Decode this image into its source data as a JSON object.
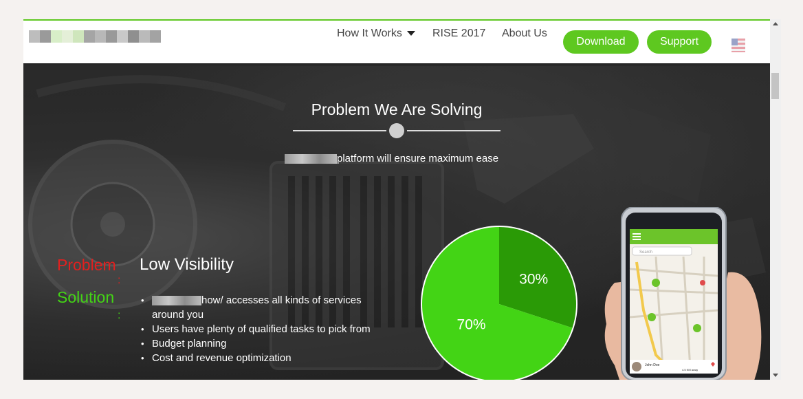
{
  "nav": {
    "how_it_works": "How It Works",
    "rise": "RISE 2017",
    "about": "About Us",
    "download": "Download",
    "support": "Support"
  },
  "colors": {
    "accent": "#5ec820",
    "problem": "#e2201f",
    "solution": "#43d415",
    "pie_light": "#43d415",
    "pie_dark": "#2a9a06"
  },
  "section": {
    "title": "Problem We Are Solving",
    "subtitle": "platform will ensure maximum ease"
  },
  "problem": {
    "problem_label": "Problem",
    "solution_label": "Solution",
    "colon": ":",
    "heading": "Low Visibility",
    "bullets": [
      "how/ accesses all kinds of services around you",
      "Users have plenty of qualified tasks to pick from",
      "Budget planning",
      "Cost and revenue optimization"
    ]
  },
  "pie": {
    "slices": [
      {
        "label": "30%",
        "value": 30
      },
      {
        "label": "70%",
        "value": 70
      }
    ]
  },
  "phone": {
    "search_placeholder": "Search",
    "user_name": "John Doe",
    "distance": "4.5 KM away"
  }
}
